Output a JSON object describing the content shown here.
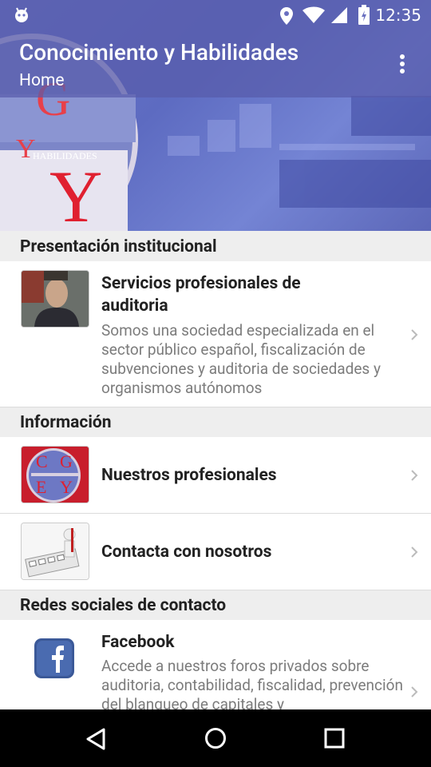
{
  "status": {
    "time": "12:35"
  },
  "toolbar": {
    "title": "Conocimiento y Habilidades",
    "subtitle": "Home",
    "logo_text": "HABILIDADES"
  },
  "sections": [
    {
      "title": "Presentación institucional",
      "items": [
        {
          "title": "Servicios profesionales de auditoria",
          "desc": "Somos una sociedad especializada en el sector público español, fiscalización de subvenciones y auditoria de sociedades y organismos autónomos"
        }
      ]
    },
    {
      "title": "Información",
      "items": [
        {
          "title": "Nuestros profesionales"
        },
        {
          "title": "Contacta con nosotros"
        }
      ]
    },
    {
      "title": "Redes sociales de contacto",
      "items": [
        {
          "title": "Facebook",
          "desc": "Accede a nuestros foros privados sobre auditoria, contabilidad, fiscalidad, prevención del blanqueo de capitales y"
        }
      ]
    }
  ],
  "logo_letters": [
    "C",
    "G",
    "E",
    "Y"
  ],
  "colors": {
    "toolbar_overlay": "#585caa",
    "section_bg": "#eeeeee",
    "facebook": "#3b5998"
  }
}
